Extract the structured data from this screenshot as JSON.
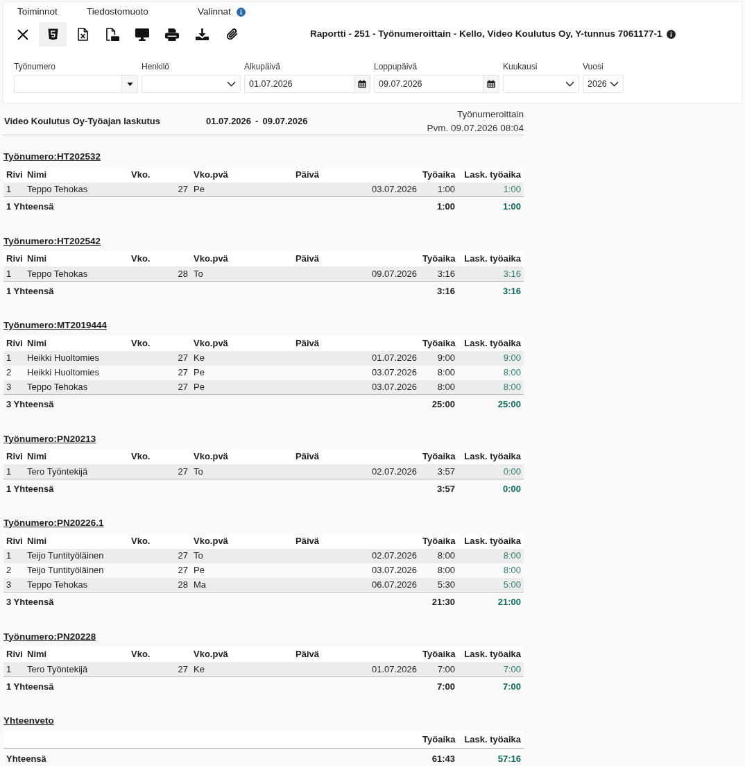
{
  "menu": [
    {
      "label": "Toiminnot",
      "info": false
    },
    {
      "label": "Tiedostomuoto",
      "info": false
    },
    {
      "label": "Valinnat",
      "info": true
    }
  ],
  "toolbar": [
    {
      "kind": "close",
      "selected": false
    },
    {
      "kind": "html",
      "selected": true
    },
    {
      "kind": "excel",
      "selected": false
    },
    {
      "kind": "pdf",
      "selected": false
    },
    {
      "kind": "screen",
      "selected": false
    },
    {
      "kind": "print",
      "selected": false
    },
    {
      "kind": "download",
      "selected": false
    },
    {
      "kind": "attach",
      "selected": false
    }
  ],
  "title": {
    "text": "Raportti - 251 - Työnumeroittain - Kello, Video Koulutus Oy, Y-tunnus 7061177-1",
    "info": true
  },
  "filters": [
    {
      "label": "Työnumero",
      "kind": "combo"
    },
    {
      "label": "Henkilö",
      "kind": "select"
    },
    {
      "label": "Alkupäivä",
      "kind": "date",
      "value": "01.07.2026"
    },
    {
      "label": "Loppupäivä",
      "kind": "date",
      "value": "09.07.2026"
    },
    {
      "label": "Kuukausi",
      "kind": "select"
    },
    {
      "label": "Vuosi",
      "kind": "select",
      "value": "2026"
    }
  ],
  "report": {
    "title": "Video Koulutus Oy-Työajan laskutus",
    "date_from": "01.07.2026",
    "date_separator": "-",
    "date_to": "09.07.2026",
    "grouping": "Työnumeroittain",
    "printed": "Pvm. 09.07.2026 08:04"
  },
  "groups": [
    {
      "heading": "Työnumero:HT202532",
      "columns": [
        "Rivi",
        "Nimi",
        "Vko.",
        "Vko.pvä",
        "Päivä",
        "Työaika",
        "Lask. työaika"
      ],
      "rows": [
        [
          "1",
          "Teppo Tehokas",
          "27",
          "Pe",
          "03.07.2026",
          "1:00",
          "1:00"
        ]
      ],
      "total": {
        "label": "1 Yhteensä",
        "values": [
          "1:00",
          "1:00"
        ]
      }
    },
    {
      "heading": "Työnumero:HT202542",
      "columns": [
        "Rivi",
        "Nimi",
        "Vko.",
        "Vko.pvä",
        "Päivä",
        "Työaika",
        "Lask. työaika"
      ],
      "rows": [
        [
          "1",
          "Teppo Tehokas",
          "28",
          "To",
          "09.07.2026",
          "3:16",
          "3:16"
        ]
      ],
      "total": {
        "label": "1 Yhteensä",
        "values": [
          "3:16",
          "3:16"
        ]
      }
    },
    {
      "heading": "Työnumero:MT2019444",
      "columns": [
        "Rivi",
        "Nimi",
        "Vko.",
        "Vko.pvä",
        "Päivä",
        "Työaika",
        "Lask. työaika"
      ],
      "rows": [
        [
          "1",
          "Heikki Huoltomies",
          "27",
          "Ke",
          "01.07.2026",
          "9:00",
          "9:00"
        ],
        [
          "2",
          "Heikki Huoltomies",
          "27",
          "Pe",
          "03.07.2026",
          "8:00",
          "8:00"
        ],
        [
          "3",
          "Teppo Tehokas",
          "27",
          "Pe",
          "03.07.2026",
          "8:00",
          "8:00"
        ]
      ],
      "total": {
        "label": "3 Yhteensä",
        "values": [
          "25:00",
          "25:00"
        ]
      }
    },
    {
      "heading": "Työnumero:PN20213",
      "columns": [
        "Rivi",
        "Nimi",
        "Vko.",
        "Vko.pvä",
        "Päivä",
        "Työaika",
        "Lask. työaika"
      ],
      "rows": [
        [
          "1",
          "Tero Työntekijä",
          "27",
          "To",
          "02.07.2026",
          "3:57",
          "0:00"
        ]
      ],
      "total": {
        "label": "1 Yhteensä",
        "values": [
          "3:57",
          "0:00"
        ]
      }
    },
    {
      "heading": "Työnumero:PN20226.1",
      "columns": [
        "Rivi",
        "Nimi",
        "Vko.",
        "Vko.pvä",
        "Päivä",
        "Työaika",
        "Lask. työaika"
      ],
      "rows": [
        [
          "1",
          "Teijo Tuntityöläinen",
          "27",
          "To",
          "02.07.2026",
          "8:00",
          "8:00"
        ],
        [
          "2",
          "Teijo Tuntityöläinen",
          "27",
          "Pe",
          "03.07.2026",
          "8:00",
          "8:00"
        ],
        [
          "3",
          "Teppo Tehokas",
          "28",
          "Ma",
          "06.07.2026",
          "5:30",
          "5:00"
        ]
      ],
      "total": {
        "label": "3 Yhteensä",
        "values": [
          "21:30",
          "21:00"
        ]
      }
    },
    {
      "heading": "Työnumero:PN20228",
      "columns": [
        "Rivi",
        "Nimi",
        "Vko.",
        "Vko.pvä",
        "Päivä",
        "Työaika",
        "Lask. työaika"
      ],
      "rows": [
        [
          "1",
          "Tero Työntekijä",
          "27",
          "Ke",
          "01.07.2026",
          "7:00",
          "7:00"
        ]
      ],
      "total": {
        "label": "1 Yhteensä",
        "values": [
          "7:00",
          "7:00"
        ]
      }
    }
  ],
  "summary": {
    "heading": "Yhteenveto",
    "columns": [
      "Työaika",
      "Lask. työaika"
    ],
    "total": {
      "label": "Yhteensä",
      "values": [
        "61:43",
        "57:16"
      ]
    }
  }
}
